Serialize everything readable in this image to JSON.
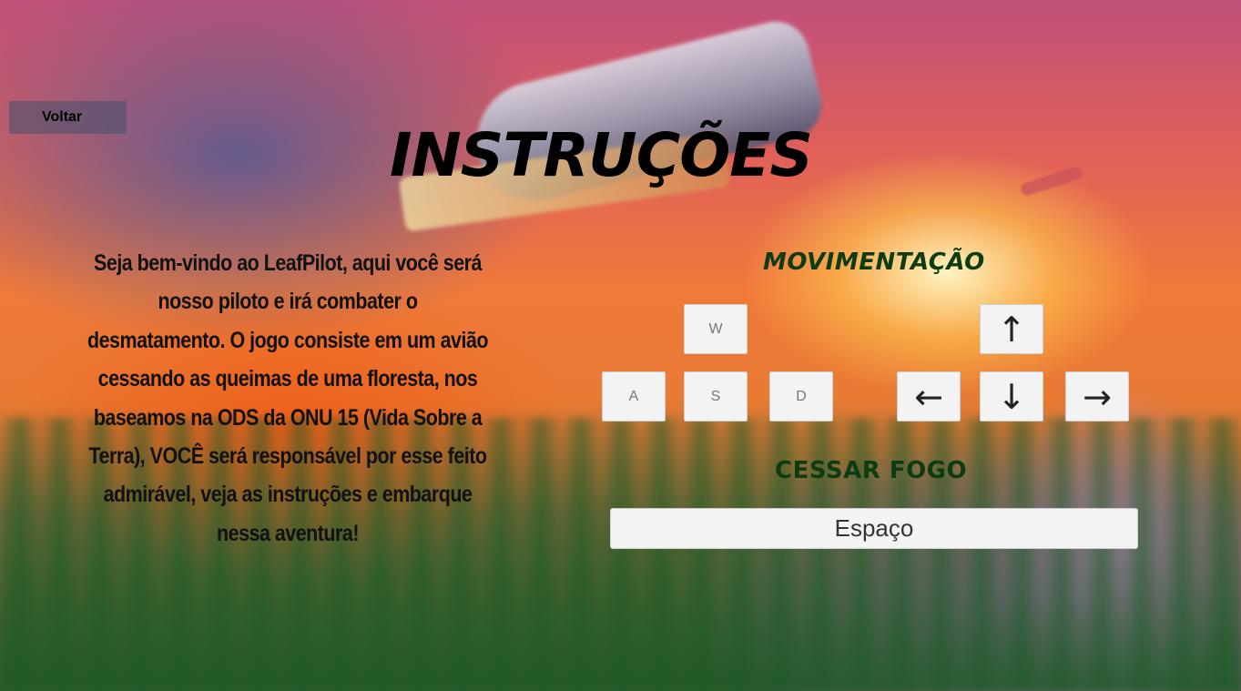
{
  "back_button": {
    "label": "Voltar"
  },
  "title": "INSTRUÇÕES",
  "intro_text": "Seja bem-vindo ao LeafPilot, aqui você será nosso piloto e irá combater o desmatamento. O jogo consiste em um avião cessando as queimas de uma floresta, nos baseamos na ODS da ONU 15 (Vida Sobre a Terra), VOCÊ será responsável por esse feito admirável, veja as instruções e embarque nessa aventura!",
  "movement": {
    "title": "MOVIMENTAÇÃO",
    "wasd_keys": {
      "up": "W",
      "left": "A",
      "down": "S",
      "right": "D"
    },
    "arrow_keys": {
      "up": "↑",
      "left": "←",
      "down": "↓",
      "right": "→"
    }
  },
  "fire": {
    "title": "CESSAR FOGO",
    "key_label": "Espaço"
  },
  "colors": {
    "section_title": "#0d3b12",
    "key_background": "#f3f3f3",
    "title": "#000000"
  }
}
